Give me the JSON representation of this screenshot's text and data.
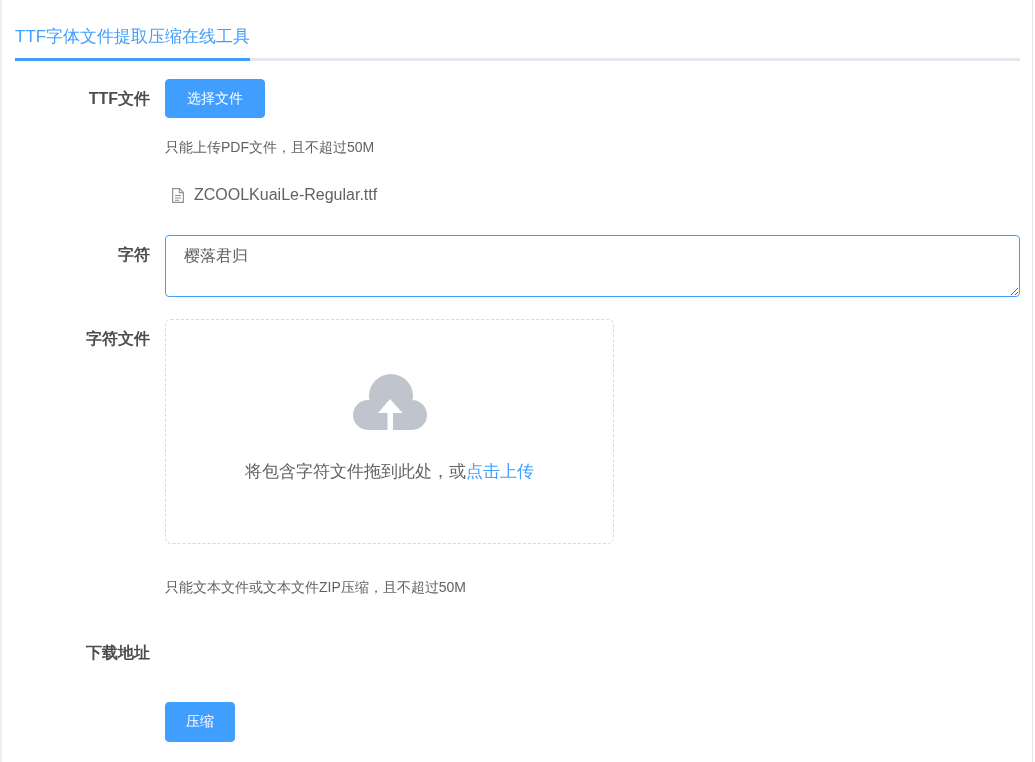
{
  "tabs": [
    {
      "label": "TTF字体文件提取压缩在线工具",
      "selected": true
    }
  ],
  "form": {
    "fields": [
      {
        "kind": "upload",
        "label": "TTF文件",
        "button": "选择文件",
        "tip": "只能上传PDF文件，且不超过50M",
        "files": [
          {
            "name": "ZCOOLKuaiLe-Regular.ttf"
          }
        ]
      },
      {
        "kind": "textarea",
        "label": "字符",
        "value": "樱落君归",
        "focused": true
      },
      {
        "kind": "dragger",
        "label": "字符文件",
        "drop_text": "将包含字符文件拖到此处，或",
        "link": "点击上传",
        "tip": "只能文本文件或文本文件ZIP压缩，且不超过50M"
      },
      {
        "kind": "label_only",
        "label": "下载地址"
      }
    ],
    "submit": "压缩"
  }
}
